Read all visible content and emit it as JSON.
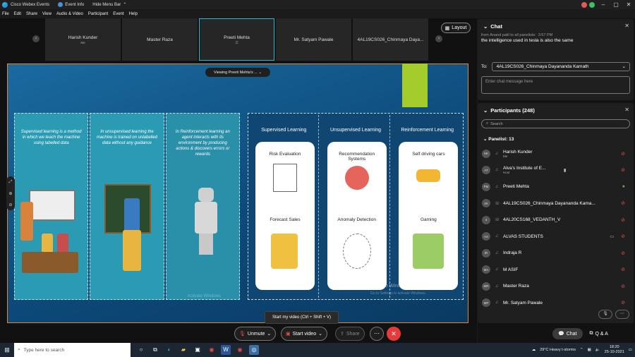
{
  "titlebar": {
    "app": "Cisco Webex Events",
    "event_info": "Event Info",
    "hide_menu": "Hide Menu Bar"
  },
  "menu": [
    "File",
    "Edit",
    "Share",
    "View",
    "Audio & Video",
    "Participant",
    "Event",
    "Help"
  ],
  "thumbnails": [
    {
      "name": "Harish Kunder",
      "sub": "Me"
    },
    {
      "name": "Master Raza",
      "sub": ""
    },
    {
      "name": "Preeti Mehta",
      "sub": ""
    },
    {
      "name": "Mr. Satyam Pawale",
      "sub": ""
    },
    {
      "name": "4AL19CS026_Chinmaya Daya...",
      "sub": ""
    }
  ],
  "layout_label": "Layout",
  "viewing_label": "Viewing Preeti Mehta's ...",
  "slide": {
    "left": [
      "Supervised learning is a method in which we teach the machine using labelled data",
      "In unsupervised learning the machine is trained on unlabelled data without any guidance",
      "In Reinforcement learning an agent interacts with its environment by producing actions & discovers errors or rewards"
    ],
    "right": [
      {
        "header": "Supervised Learning",
        "item1": "Risk Evaluation",
        "item2": "Forecast Sales"
      },
      {
        "header": "Unsupervised Learning",
        "item1": "Recommendation Systems",
        "item2": "Anomaly Detection"
      },
      {
        "header": "Reinforcement Learning",
        "item1": "Self driving cars",
        "item2": "Gaming"
      }
    ],
    "watermark1": "Activate Windows",
    "watermark2": "Activate Windows",
    "watermark2_sub": "Go to Settings to activate Windows."
  },
  "tooltip": "Start my video (Ctrl + Shift + V)",
  "controls": {
    "unmute": "Unmute",
    "start_video": "Start video",
    "share": "Share"
  },
  "chat": {
    "title": "Chat",
    "from": "from Anand patil to all panelists:",
    "time": "3:57 PM",
    "message": "the intelligence used in tesla is also the same",
    "to_label": "To:",
    "to_value": "4AL19CS026_Chinmaya Dayananda Kamath",
    "input_placeholder": "Enter chat message here"
  },
  "participants": {
    "title": "Participants (248)",
    "search_placeholder": "Search",
    "section": "Panelist: 13",
    "list": [
      {
        "initials": "HK",
        "name": "Harish Kunder",
        "role": "Me",
        "status": "muted"
      },
      {
        "initials": "AT",
        "name": "Alva's Institute of E...",
        "role": "Host",
        "status": "muted"
      },
      {
        "initials": "PM",
        "name": "Preeti Mehta",
        "role": "",
        "status": "unmuted"
      },
      {
        "initials": "4K",
        "name": "4AL19CS026_Chinmaya Dayananda Kama...",
        "role": "",
        "status": "muted"
      },
      {
        "initials": "4",
        "name": "4AL20CS168_VEDANTH_V",
        "role": "",
        "status": "muted"
      },
      {
        "initials": "AS",
        "name": "ALVAS STUDENTS",
        "role": "",
        "status": "muted"
      },
      {
        "initials": "IR",
        "name": "Indraja R",
        "role": "",
        "status": "muted"
      },
      {
        "initials": "MA",
        "name": "M ASIF",
        "role": "",
        "status": "muted"
      },
      {
        "initials": "MR",
        "name": "Master Raza",
        "role": "",
        "status": "muted"
      },
      {
        "initials": "MP",
        "name": "Mr. Satyam Pawale",
        "role": "",
        "status": "muted"
      }
    ]
  },
  "bottom": {
    "chat": "Chat",
    "qa": "Q & A"
  },
  "taskbar": {
    "search_placeholder": "Type here to search",
    "weather": "29°C Heavy t-storms",
    "time": "18:20",
    "date": "25-10-2021"
  }
}
